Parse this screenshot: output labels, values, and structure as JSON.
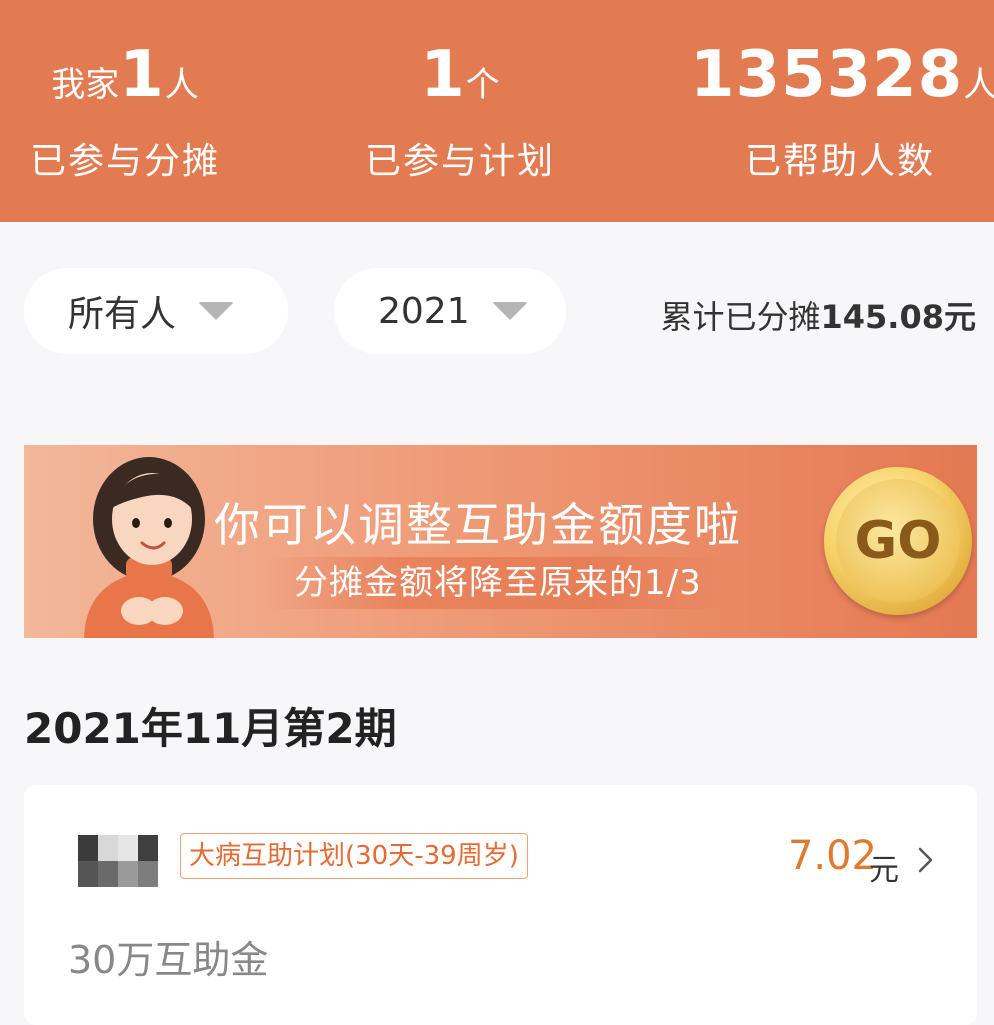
{
  "stats": [
    {
      "prefix": "我家",
      "number": "1",
      "unit": "人",
      "label": "已参与分摊"
    },
    {
      "prefix": "",
      "number": "1",
      "unit": "个",
      "label": "已参与计划"
    },
    {
      "prefix": "",
      "number": "135328",
      "unit": "人",
      "label": "已帮助人数"
    }
  ],
  "filters": {
    "person": "所有人",
    "year": "2021",
    "total_prefix": "累计已分摊",
    "total_amount": "145.08元"
  },
  "banner": {
    "title": "你可以调整互助金额度啦",
    "subtitle": "分摊金额将降至原来的1/3",
    "button": "GO"
  },
  "period": {
    "title": "2021年11月第2期"
  },
  "card": {
    "plan_name": "大病互助计划(30天-39周岁)",
    "amount": "7.02",
    "unit": "元",
    "coverage": "30万互助金"
  },
  "colors": {
    "header_bg": "#e27a52",
    "accent_orange": "#e07a2f",
    "tag_border": "#f0a27a"
  },
  "icons": [
    "caret-down-icon",
    "chevron-right-icon",
    "go-coin-icon"
  ]
}
